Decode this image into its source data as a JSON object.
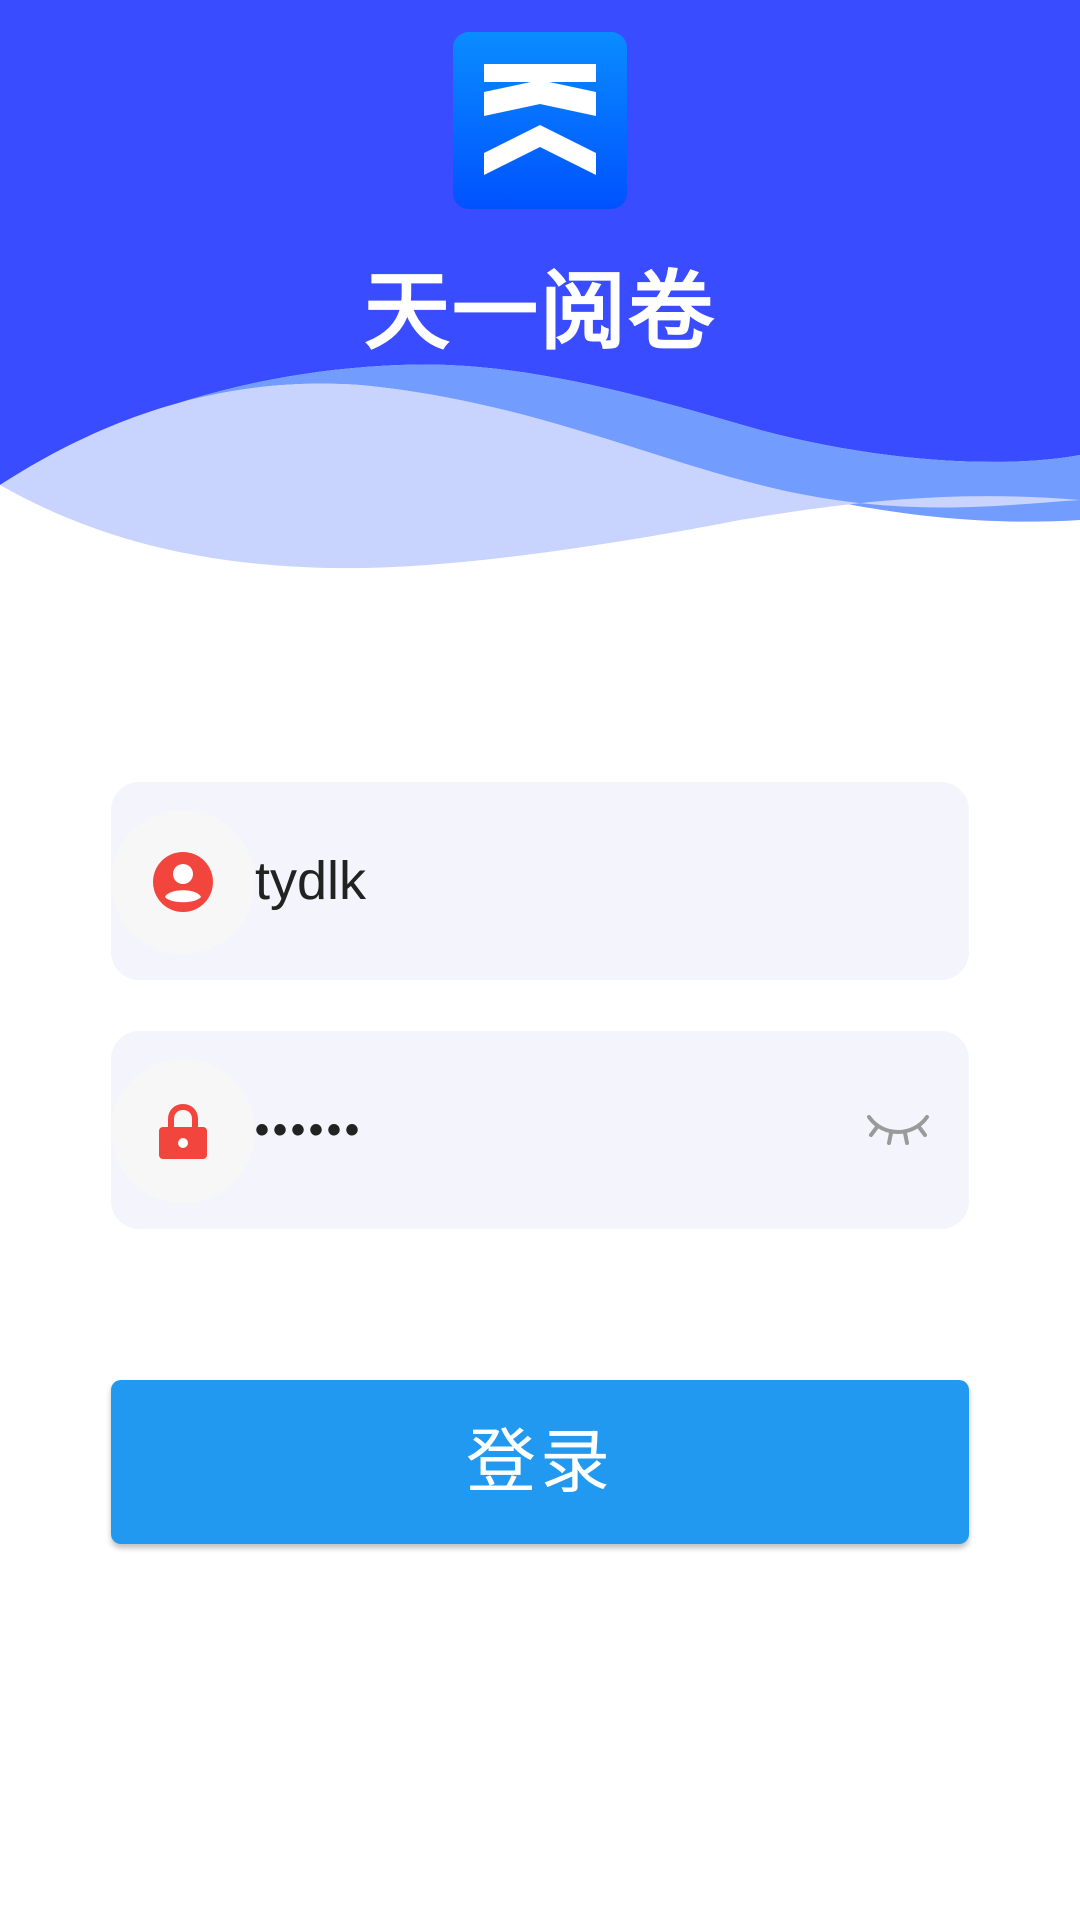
{
  "app": {
    "title": "天一阅卷",
    "logo_icon": "tianyi-logo-icon"
  },
  "colors": {
    "header_blue": "#3a4cff",
    "wave_light": "#c8d3fe",
    "wave_mid": "#739cff",
    "field_bg": "#f4f5fc",
    "icon_red": "#f2453d",
    "button_blue": "#2299f0"
  },
  "login_form": {
    "username": {
      "icon": "user-icon",
      "value": "tydlk"
    },
    "password": {
      "icon": "lock-icon",
      "value": "••••••",
      "visibility_icon": "eye-closed-icon"
    },
    "submit_label": "登录"
  }
}
